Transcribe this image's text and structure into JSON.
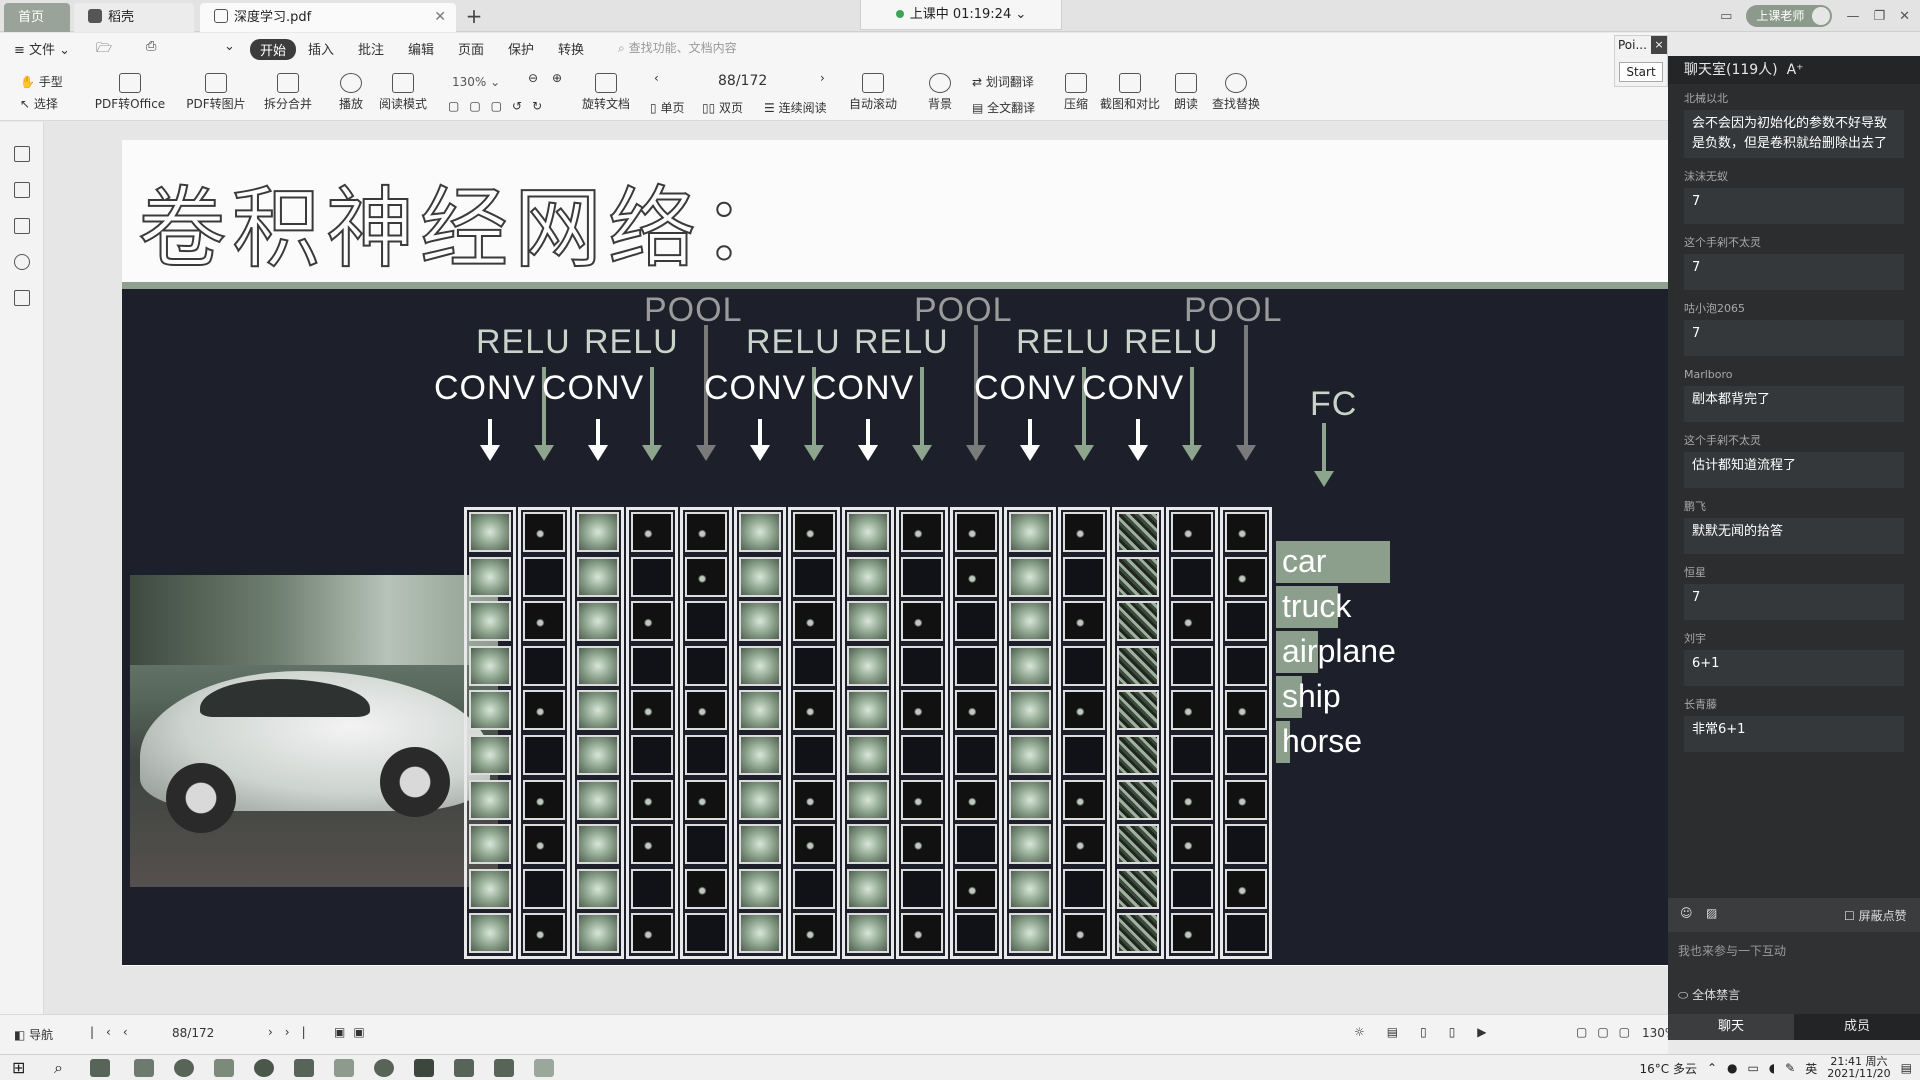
{
  "tabs": {
    "home": "首页",
    "daoke": "稻壳",
    "doc": "深度学习.pdf",
    "new": "+"
  },
  "timer": {
    "label": "上课中 01:19:24",
    "chevron": "⌄"
  },
  "window": {
    "user": "上课老师"
  },
  "ribbon": {
    "file": "文件",
    "menus": [
      "开始",
      "插入",
      "批注",
      "编辑",
      "页面",
      "保护",
      "转换"
    ],
    "search": "查找功能、文档内容",
    "hand": "手型",
    "select": "选择",
    "tools": [
      "PDF转Office",
      "PDF转图片",
      "拆分合并",
      "播放",
      "阅读模式",
      "旋转文档",
      "自动滚动",
      "背景",
      "压缩",
      "截图和对比",
      "朗读",
      "查找替换"
    ],
    "zoom": "130%",
    "page": "88/172",
    "single": "单页",
    "double": "双页",
    "continuous": "连续阅读",
    "word_translate": "划词翻译",
    "full_translate": "全文翻译"
  },
  "poi": {
    "title": "Poi...",
    "close": "×",
    "start": "Start"
  },
  "slide": {
    "title": "卷积神经网络：",
    "conv": "CONV",
    "relu": "RELU",
    "pool": "POOL",
    "fc": "FC",
    "classes": [
      "car",
      "truck",
      "airplane",
      "ship",
      "horse"
    ],
    "fc_scores": [
      0.95,
      0.52,
      0.35,
      0.22,
      0.12
    ]
  },
  "status": {
    "nav": "导航",
    "page": "88/172",
    "zoom": "130%"
  },
  "chat": {
    "header": "聊天室(119人)",
    "font_btn": "A⁺",
    "messages": [
      {
        "user": "北械以北",
        "text": "会不会因为初始化的参数不好导致是负数，但是卷积就给删除出去了"
      },
      {
        "user": "沫沫无蚁",
        "text": "7"
      },
      {
        "user": "这个手剁不太灵",
        "text": "7"
      },
      {
        "user": "咕小泡2065",
        "text": "7"
      },
      {
        "user": "Marlboro",
        "text": "剧本都背完了"
      },
      {
        "user": "这个手剁不太灵",
        "text": "估计都知道流程了"
      },
      {
        "user": "鹏飞",
        "text": "默默无闻的拾答"
      },
      {
        "user": "恒星",
        "text": "7"
      },
      {
        "user": "刘宇",
        "text": "6+1"
      },
      {
        "user": "长青藤",
        "text": "非常6+1"
      }
    ],
    "shield": "屏蔽点赞",
    "input_placeholder": "我也来参与一下互动",
    "mute_all": "全体禁言",
    "tab_chat": "聊天",
    "tab_members": "成员"
  },
  "taskbar": {
    "weather": "16°C 多云",
    "ime": "英",
    "time": "21:41 周六",
    "date": "2021/11/20"
  }
}
